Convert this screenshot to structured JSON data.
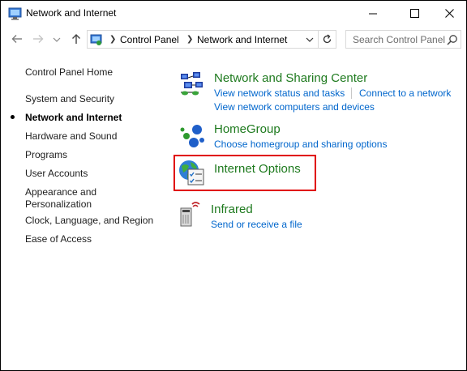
{
  "window": {
    "title": "Network and Internet",
    "minimize_icon": "minimize-icon",
    "maximize_icon": "maximize-icon",
    "close_icon": "close-icon"
  },
  "address_bar": {
    "crumbs": [
      "Control Panel",
      "Network and Internet"
    ],
    "search_placeholder": "Search Control Panel"
  },
  "left_nav": {
    "items": [
      "Control Panel Home",
      "System and Security",
      "Network and Internet",
      "Hardware and Sound",
      "Programs",
      "User Accounts",
      "Appearance and",
      "Personalization",
      "Clock, Language, and Region",
      "Ease of Access"
    ],
    "current_index": 2
  },
  "categories": [
    {
      "title": "Network and Sharing Center",
      "icon": "network-sharing-icon",
      "links": [
        "View network status and tasks",
        "Connect to a network",
        "View network computers and devices"
      ]
    },
    {
      "title": "HomeGroup",
      "icon": "homegroup-icon",
      "links": [
        "Choose homegroup and sharing options"
      ]
    },
    {
      "title": "Internet Options",
      "icon": "internet-options-icon",
      "links": []
    },
    {
      "title": "Infrared",
      "icon": "infrared-icon",
      "links": [
        "Send or receive a file"
      ]
    }
  ],
  "colors": {
    "category_title": "#1e7a1e",
    "link": "#0066cc",
    "highlight": "#e00000"
  }
}
